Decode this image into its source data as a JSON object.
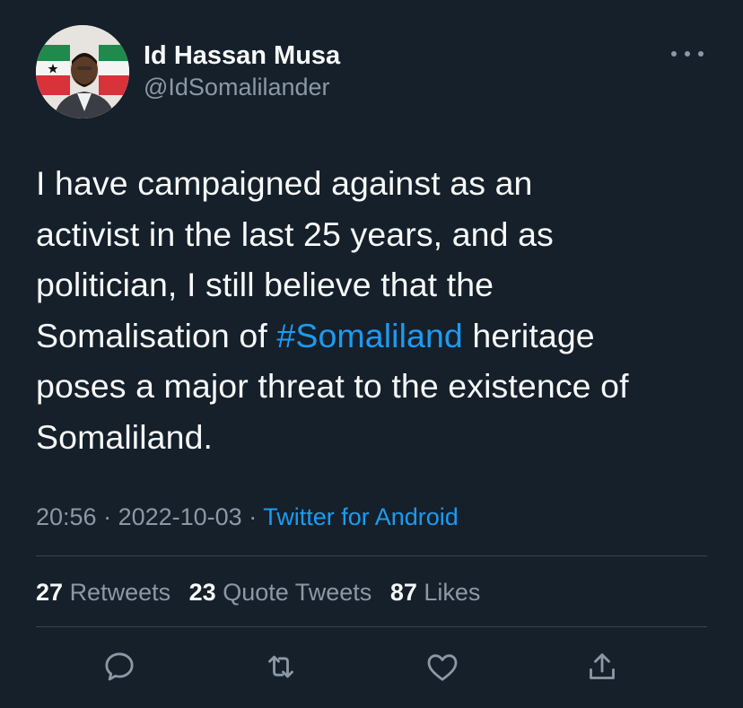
{
  "user": {
    "display_name": "Id Hassan Musa",
    "handle": "@IdSomalilander"
  },
  "tweet": {
    "lines": [
      {
        "before": "I have campaigned against as an",
        "hashtag": "",
        "after": ""
      },
      {
        "before": "activist in the last 25 years, and as",
        "hashtag": "",
        "after": ""
      },
      {
        "before": "politician, I still believe that the",
        "hashtag": "",
        "after": ""
      },
      {
        "before": "Somalisation of ",
        "hashtag": "#Somaliland",
        "after": " heritage"
      },
      {
        "before": "poses a major threat to the existence of",
        "hashtag": "",
        "after": ""
      },
      {
        "before": "Somaliland.",
        "hashtag": "",
        "after": ""
      }
    ]
  },
  "meta": {
    "time": "20:56",
    "sep1": " · ",
    "date": "2022-10-03",
    "sep2": " · ",
    "source": "Twitter for Android"
  },
  "stats": {
    "retweets_count": "27",
    "retweets_label": "Retweets",
    "quotes_count": "23",
    "quotes_label": "Quote Tweets",
    "likes_count": "87",
    "likes_label": "Likes"
  },
  "actions": {
    "reply_icon": "reply-icon",
    "retweet_icon": "retweet-icon",
    "like_icon": "heart-icon",
    "share_icon": "share-icon"
  },
  "colors": {
    "background": "#15202b",
    "text": "#f7f9f9",
    "secondary": "#8b98a5",
    "link": "#1d9bf0",
    "divider": "#38444d"
  }
}
